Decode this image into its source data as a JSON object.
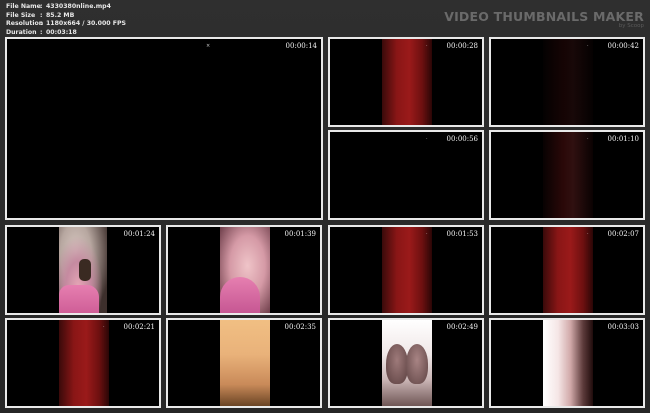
{
  "file_info": {
    "file_name_label": "File Name",
    "file_name": "4330380nline.mp4",
    "file_size_label": "File Size",
    "file_size": "85.2 MB",
    "resolution_label": "Resolution",
    "resolution": "1180x664 / 30.000 FPS",
    "duration_label": "Duration",
    "duration": "00:03:18",
    "separator": ":"
  },
  "brand": {
    "title": "VIDEO THUMBNAILS MAKER",
    "subtitle": "by Scoop"
  },
  "thumbnails": [
    {
      "timestamp": "00:00:14",
      "mark": "×"
    },
    {
      "timestamp": "00:00:28",
      "mark": "·"
    },
    {
      "timestamp": "00:00:42",
      "mark": "·"
    },
    {
      "timestamp": "00:00:56",
      "mark": "·"
    },
    {
      "timestamp": "00:01:10",
      "mark": "·"
    },
    {
      "timestamp": "00:01:24",
      "mark": ""
    },
    {
      "timestamp": "00:01:39",
      "mark": ""
    },
    {
      "timestamp": "00:01:53",
      "mark": "·"
    },
    {
      "timestamp": "00:02:07",
      "mark": "·"
    },
    {
      "timestamp": "00:02:21",
      "mark": "·"
    },
    {
      "timestamp": "00:02:35",
      "mark": ""
    },
    {
      "timestamp": "00:02:49",
      "mark": ""
    },
    {
      "timestamp": "00:03:03",
      "mark": ""
    }
  ]
}
